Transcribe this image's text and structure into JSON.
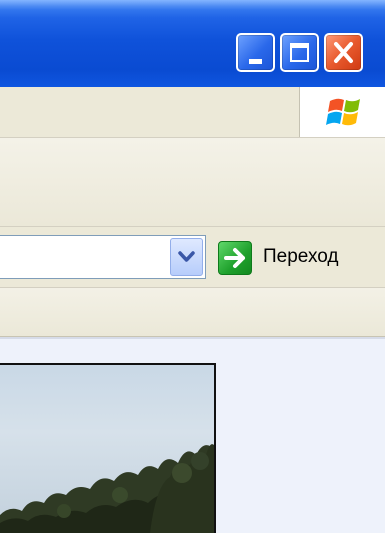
{
  "window": {
    "controls": {
      "minimize_icon": "minimize-icon",
      "maximize_icon": "maximize-icon",
      "close_icon": "close-icon"
    }
  },
  "menubar": {
    "logo_icon": "windows-logo-icon"
  },
  "addressbar": {
    "url_value": "",
    "dropdown_icon": "chevron-down-icon",
    "go_icon": "go-arrow-icon",
    "go_label": "Переход"
  },
  "content": {
    "image": "photo-trees-sky"
  },
  "colors": {
    "titlebar_blue": "#0a4bd2",
    "close_red": "#e85a2e",
    "go_green": "#1fa02c",
    "chrome_beige": "#ece9d8"
  }
}
